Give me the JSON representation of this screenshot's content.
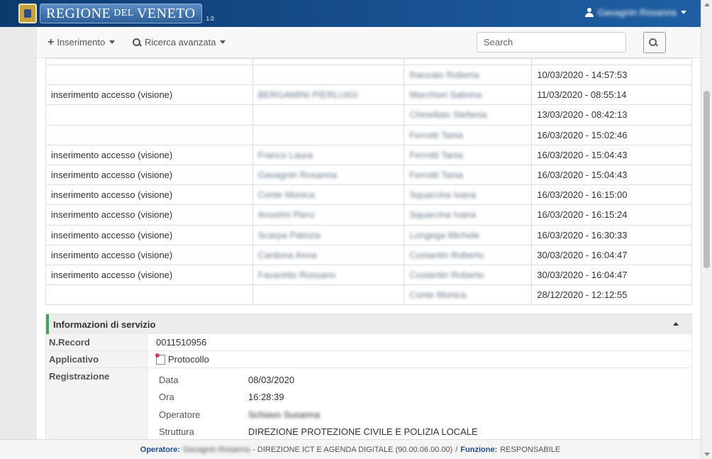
{
  "header": {
    "logo_main": "REGIONE",
    "logo_small": "DEL",
    "logo_end": "VENETO",
    "version": "1.0",
    "user_name": "Gavagnin Rosanna"
  },
  "toolbar": {
    "insert_label": "Inserimento",
    "advanced_search_label": "Ricerca avanzata",
    "search_placeholder": "Search"
  },
  "access_rows": [
    {
      "action": "",
      "by": "",
      "to": "",
      "date": ""
    },
    {
      "action": "",
      "by": "",
      "to": "Ranzato Roberta",
      "date": "10/03/2020 - 14:57:53"
    },
    {
      "action": "inserimento accesso  (visione)",
      "by": "BERGAMINI PIERLUIGI",
      "to": "Marchiori Sabrina",
      "date": "11/03/2020 - 08:55:14"
    },
    {
      "action": "",
      "by": "",
      "to": "Chinellato Stefania",
      "date": "13/03/2020 - 08:42:13"
    },
    {
      "action": "",
      "by": "",
      "to": "Ferrotti Tania",
      "date": "16/03/2020 - 15:02:46"
    },
    {
      "action": "inserimento accesso  (visione)",
      "by": "Franco Laura",
      "to": "Ferrotti Tania",
      "date": "16/03/2020 - 15:04:43"
    },
    {
      "action": "inserimento accesso  (visione)",
      "by": "Gavagnin Rosanna",
      "to": "Ferrotti Tania",
      "date": "16/03/2020 - 15:04:43"
    },
    {
      "action": "inserimento accesso  (visione)",
      "by": "Conte Monica",
      "to": "Squarcina Ivana",
      "date": "16/03/2020 - 16:15:00"
    },
    {
      "action": "inserimento accesso  (visione)",
      "by": "Anselmi Piero",
      "to": "Squarcina Ivana",
      "date": "16/03/2020 - 16:15:24"
    },
    {
      "action": "inserimento accesso  (visione)",
      "by": "Scarpa Patrizia",
      "to": "Longega Michele",
      "date": "16/03/2020 - 16:30:33"
    },
    {
      "action": "inserimento accesso  (visione)",
      "by": "Cardona Anna",
      "to": "Costantin Roberto",
      "date": "30/03/2020 - 16:04:47"
    },
    {
      "action": "inserimento accesso  (visione)",
      "by": "Favaretto Rossano",
      "to": "Costantin Roberto",
      "date": "30/03/2020 - 16:04:47"
    },
    {
      "action": "",
      "by": "",
      "to": "Conte Monica",
      "date": "28/12/2020 - 12:12:55"
    }
  ],
  "service_info": {
    "title": "Informazioni di servizio",
    "nrecord_label": "N.Record",
    "nrecord_value": "0011510956",
    "app_label": "Applicativo",
    "app_value": "Protocollo",
    "reg_label": "Registrazione",
    "reg": {
      "data_label": "Data",
      "data_value": "08/03/2020",
      "ora_label": "Ora",
      "ora_value": "16:28:39",
      "operatore_label": "Operatore",
      "operatore_value": "Schiavo Susanna",
      "struttura_label": "Struttura",
      "struttura_value": "DIREZIONE PROTEZIONE CIVILE E POLIZIA LOCALE"
    }
  },
  "footer": {
    "operator_label": "Operatore:",
    "operator_name": "Gavagnin Rosanna",
    "dept": "- DIREZIONE ICT E AGENDA DIGITALE (90.00.06.00.00)",
    "sep": "/",
    "function_label": "Funzione:",
    "function_value": "RESPONSABILE"
  }
}
